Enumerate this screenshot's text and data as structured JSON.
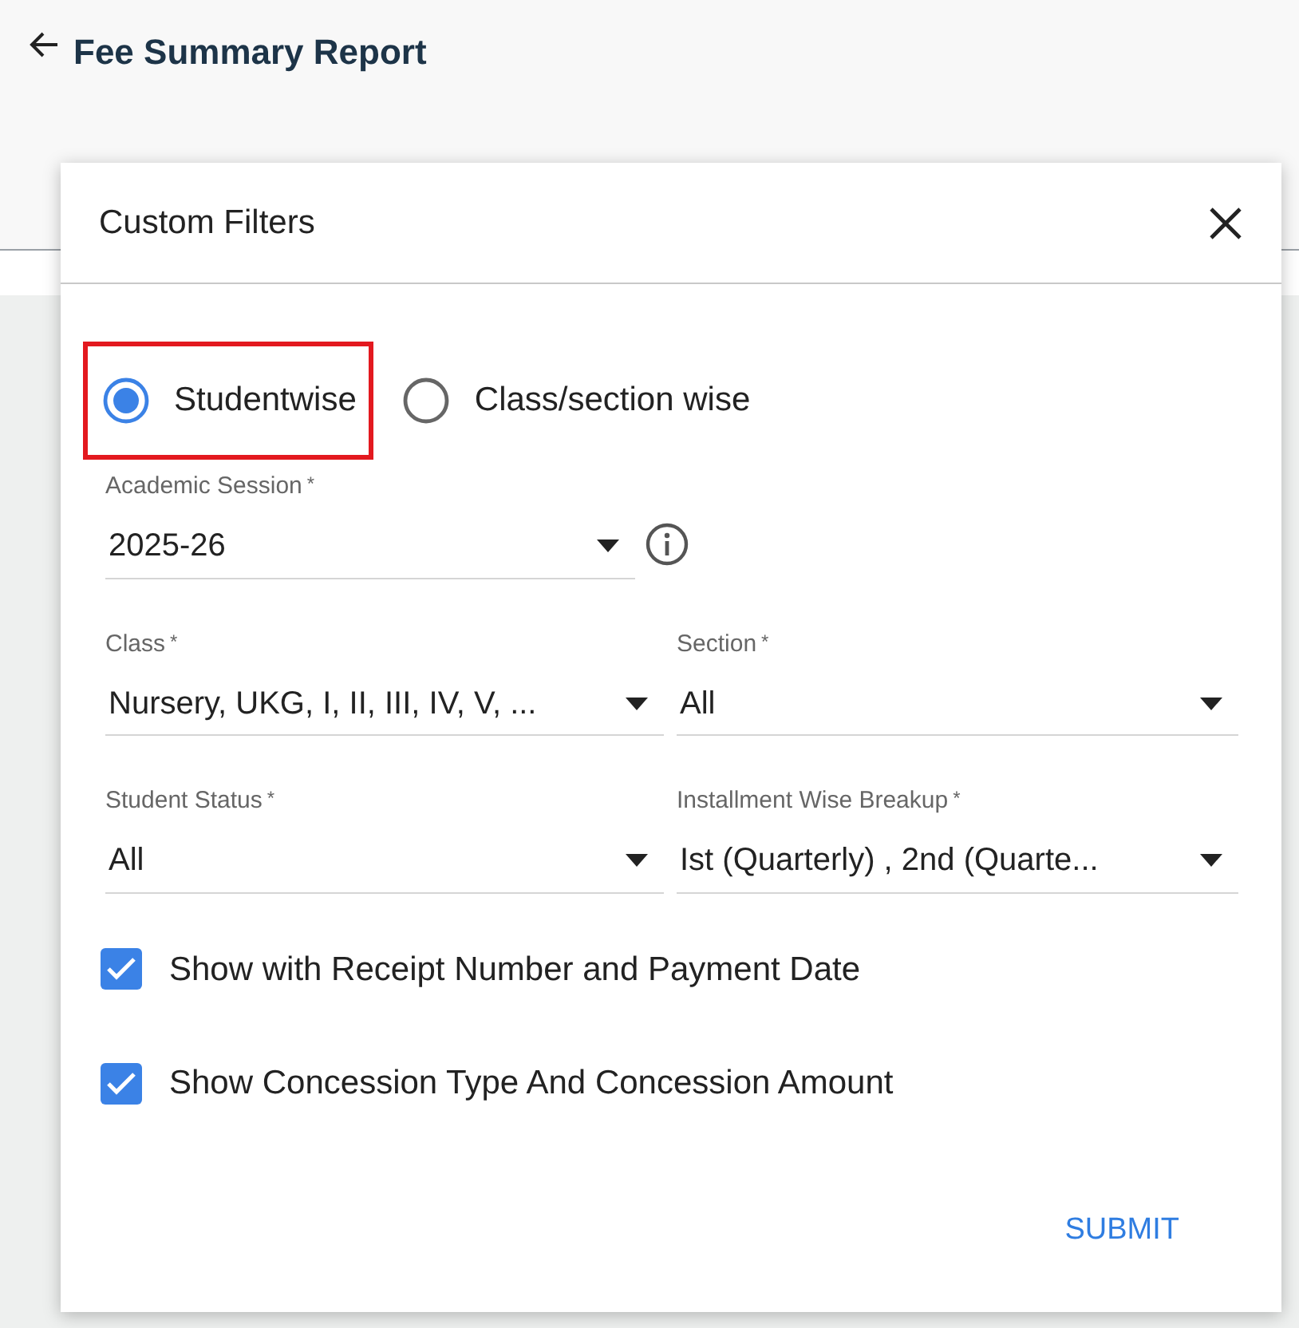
{
  "page": {
    "title": "Fee Summary Report"
  },
  "dialog": {
    "title": "Custom Filters",
    "report_types": [
      {
        "label": "Studentwise",
        "selected": true,
        "highlighted": true
      },
      {
        "label": "Class/section wise",
        "selected": false,
        "highlighted": false
      }
    ],
    "session": {
      "label": "Academic Session",
      "required_mark": "*",
      "value": "2025-26"
    },
    "fields": [
      {
        "label": "Class",
        "required_mark": "*",
        "value": "Nursery, UKG, I, II, III, IV, V, ..."
      },
      {
        "label": "Section",
        "required_mark": "*",
        "value": "All"
      },
      {
        "label": "Student Status",
        "required_mark": "*",
        "value": "All"
      },
      {
        "label": "Installment Wise Breakup",
        "required_mark": "*",
        "value": "Ist (Quarterly) , 2nd (Quarte..."
      }
    ],
    "options": [
      {
        "label": "Show with Receipt Number and Payment Date",
        "checked": true
      },
      {
        "label": "Show Concession Type And Concession Amount",
        "checked": true
      }
    ],
    "submit": "SUBMIT"
  }
}
